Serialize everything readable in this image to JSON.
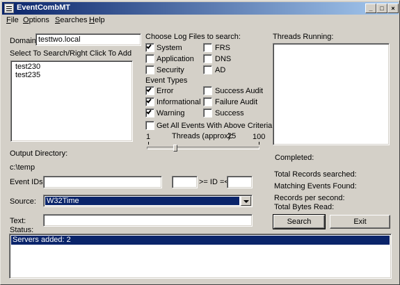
{
  "window": {
    "title": "EventCombMT",
    "minimize": "_",
    "maximize": "□",
    "close": "×"
  },
  "menu": {
    "file": {
      "u": "F",
      "rest": "ile"
    },
    "options": {
      "u": "O",
      "rest": "ptions"
    },
    "searches": {
      "u": "S",
      "rest": "earches"
    },
    "help": {
      "u": "H",
      "rest": "elp"
    }
  },
  "domain": {
    "label": "Domain:",
    "value": "testtwo.local"
  },
  "servers": {
    "label": "Select To Search/Right Click To Add",
    "items": [
      "test230",
      "test235"
    ]
  },
  "log_files": {
    "heading": "Choose Log Files to search:",
    "system": {
      "label": "System",
      "checked": true
    },
    "application": {
      "label": "Application",
      "checked": false
    },
    "security": {
      "label": "Security",
      "checked": false
    },
    "frs": {
      "label": "FRS",
      "checked": false
    },
    "dns": {
      "label": "DNS",
      "checked": false
    },
    "ad": {
      "label": "AD",
      "checked": false
    }
  },
  "event_types": {
    "heading": "Event Types",
    "error": {
      "label": "Error",
      "checked": true
    },
    "informational": {
      "label": "Informational",
      "checked": true
    },
    "warning": {
      "label": "Warning",
      "checked": true
    },
    "success_audit": {
      "label": "Success Audit",
      "checked": false
    },
    "failure_audit": {
      "label": "Failure Audit",
      "checked": false
    },
    "success": {
      "label": "Success",
      "checked": false
    }
  },
  "get_all": {
    "label": "Get All Events With Above Criteria",
    "checked": false
  },
  "threads": {
    "min": "1",
    "max": "100",
    "label": "Threads (approx):",
    "value": "25"
  },
  "threads_running": {
    "label": "Threads Running:"
  },
  "completed": {
    "label": "Completed:"
  },
  "output_dir": {
    "label": "Output Directory:",
    "value": "c:\\temp"
  },
  "event_ids": {
    "label": "Event IDs:",
    "value": "",
    "range_label": ">= ID =<",
    "min_value": "",
    "max_value": ""
  },
  "source": {
    "label": "Source:",
    "value": "W32Time"
  },
  "text": {
    "label": "Text:",
    "value": ""
  },
  "stats": {
    "total_records": "Total Records searched:",
    "matching_events": "Matching Events Found:",
    "records_per_second": "Records per second:",
    "total_bytes": "Total Bytes Read:"
  },
  "buttons": {
    "search": "Search",
    "exit": "Exit"
  },
  "status": {
    "label": "Status:",
    "lines": [
      "Servers added: 2"
    ]
  }
}
